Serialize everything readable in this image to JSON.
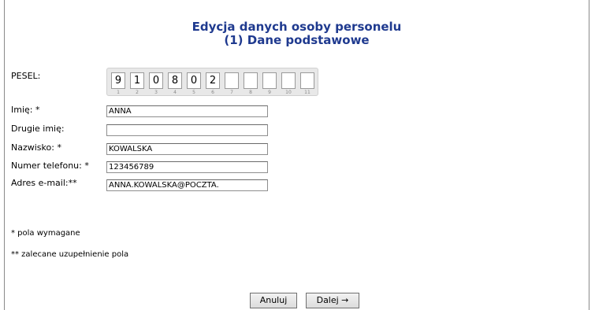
{
  "header": {
    "title_line1": "Edycja danych osoby personelu",
    "title_line2": "(1) Dane podstawowe"
  },
  "pesel": {
    "label": "PESEL:",
    "digits": [
      "9",
      "1",
      "0",
      "8",
      "0",
      "2",
      "",
      "",
      "",
      "",
      ""
    ],
    "indices": [
      "1",
      "2",
      "3",
      "4",
      "5",
      "6",
      "7",
      "8",
      "9",
      "10",
      "11"
    ]
  },
  "fields": {
    "first_name": {
      "label": "Imię: *",
      "value": "ANNA"
    },
    "second_name": {
      "label": "Drugie imię:",
      "value": ""
    },
    "last_name": {
      "label": "Nazwisko: *",
      "value": "KOWALSKA"
    },
    "phone": {
      "label": "Numer telefonu: *",
      "value": "123456789"
    },
    "email": {
      "label": "Adres e-mail:**",
      "value": "ANNA.KOWALSKA@POCZTA."
    }
  },
  "notes": {
    "required": "* pola wymagane",
    "recommended": "** zalecane uzupełnienie pola"
  },
  "buttons": {
    "cancel": "Anuluj",
    "next": "Dalej →"
  },
  "colors": {
    "title": "#1f3a8f"
  }
}
